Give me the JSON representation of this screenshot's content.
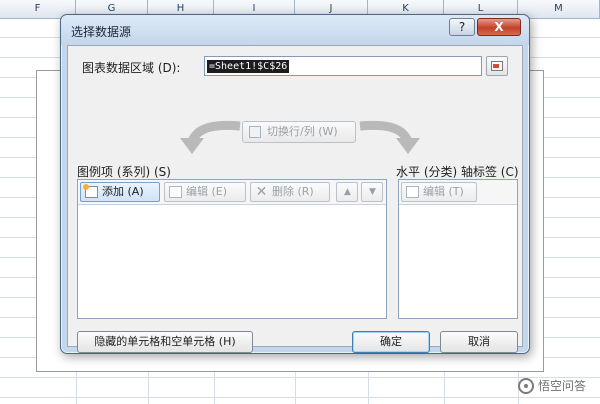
{
  "spreadsheet": {
    "columns": [
      "F",
      "G",
      "H",
      "I",
      "J",
      "K",
      "L",
      "M"
    ]
  },
  "watermark": {
    "text": "悟空问答"
  },
  "dialog": {
    "title": "选择数据源",
    "help_label": "?",
    "close_label": "X",
    "range_label": "图表数据区域 (D):",
    "range_value": "=Sheet1!$C$26",
    "switch_label": "切换行/列 (W)",
    "legend_section_label": "图例项 (系列) (S)",
    "axis_section_label": "水平 (分类) 轴标签 (C)",
    "legend_toolbar": {
      "add_label": "添加 (A)",
      "edit_label": "编辑 (E)",
      "delete_label": "删除 (R)",
      "up_symbol": "▲",
      "down_symbol": "▼"
    },
    "axis_toolbar": {
      "edit_label": "编辑 (T)"
    },
    "hidden_cells_label": "隐藏的单元格和空单元格 (H)",
    "ok_label": "确定",
    "cancel_label": "取消"
  },
  "colors": {
    "dialog_frame": "#c4d6ec",
    "close_button": "#c5402a",
    "selection": "#1d1d1d"
  }
}
